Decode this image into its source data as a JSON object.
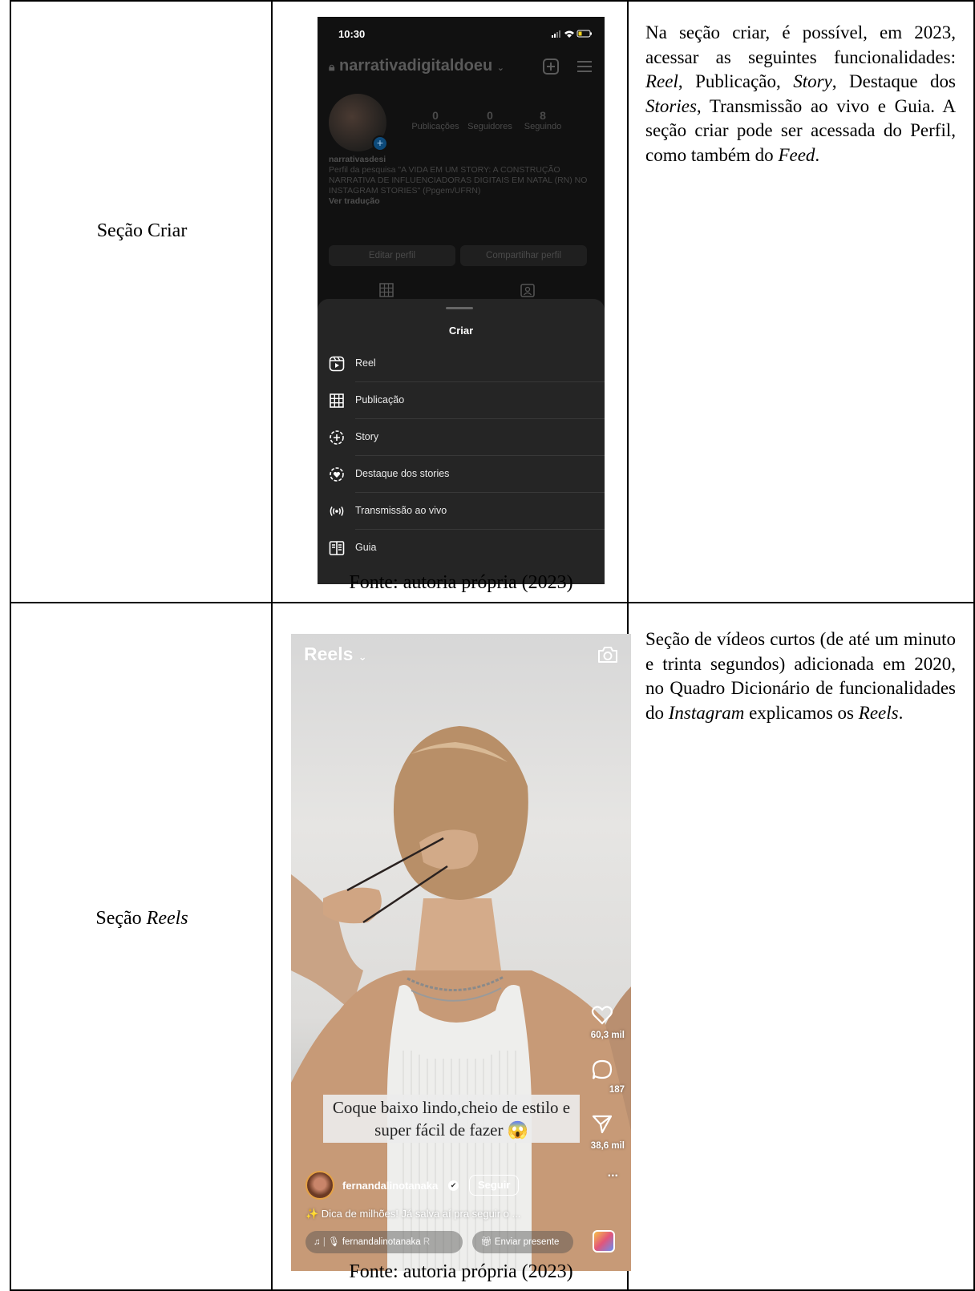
{
  "rows": [
    {
      "label_text": "Seção Criar",
      "description": "Na seção criar, é possível, em 2023, acessar as seguintes funcionalidades: Reel, Publicação, Story, Destaque dos Stories, Transmissão ao vivo e Guia. A seção criar pode ser acessada do Perfil, como também do Feed.",
      "caption": "Fonte: autoria própria (2023)",
      "phone": {
        "time": "10:30",
        "username": "narrativadigitaldoeu",
        "stats": [
          {
            "value": "0",
            "label": "Publicações"
          },
          {
            "value": "0",
            "label": "Seguidores"
          },
          {
            "value": "8",
            "label": "Seguindo"
          }
        ],
        "display_name": "narrativasdesi",
        "bio": "Perfil da pesquisa \"A VIDA EM UM STORY: A CONSTRUÇÃO NARRATIVA DE INFLUENCIADORAS DIGITAIS EM NATAL (RN) NO INSTAGRAM STORIES\" (Ppgem/UFRN)",
        "see_translation": "Ver tradução",
        "edit_profile": "Editar perfil",
        "share_profile": "Compartilhar perfil",
        "sheet_title": "Criar",
        "menu": [
          {
            "label": "Reel",
            "icon": "reel-icon"
          },
          {
            "label": "Publicação",
            "icon": "grid-post-icon"
          },
          {
            "label": "Story",
            "icon": "story-plus-icon"
          },
          {
            "label": "Destaque dos stories",
            "icon": "highlight-heart-icon"
          },
          {
            "label": "Transmissão ao vivo",
            "icon": "live-broadcast-icon"
          },
          {
            "label": "Guia",
            "icon": "guide-book-icon"
          }
        ]
      }
    },
    {
      "label_prefix": "Seção ",
      "label_italic": "Reels",
      "description": "Seção de vídeos curtos (de até um minuto e trinta segundos) adicionada em 2020, no Quadro Dicionário de funcionalidades do Instagram explicamos os Reels.",
      "caption": "Fonte: autoria própria (2023)",
      "phone": {
        "title": "Reels",
        "likes": "60,3 mil",
        "comments": "187",
        "shares": "38,6 mil",
        "more": "...",
        "overlay_caption": "Coque baixo lindo,cheio de estilo e super fácil de fazer 😱",
        "account": "fernandalinotanaka",
        "follow": "Seguir",
        "description": "✨ Dica de milhões! Já salva aí pra seguir o ...",
        "audio_author": "fernandalinotanaka",
        "audio_extra": "R",
        "gift": "Enviar presente"
      }
    }
  ]
}
